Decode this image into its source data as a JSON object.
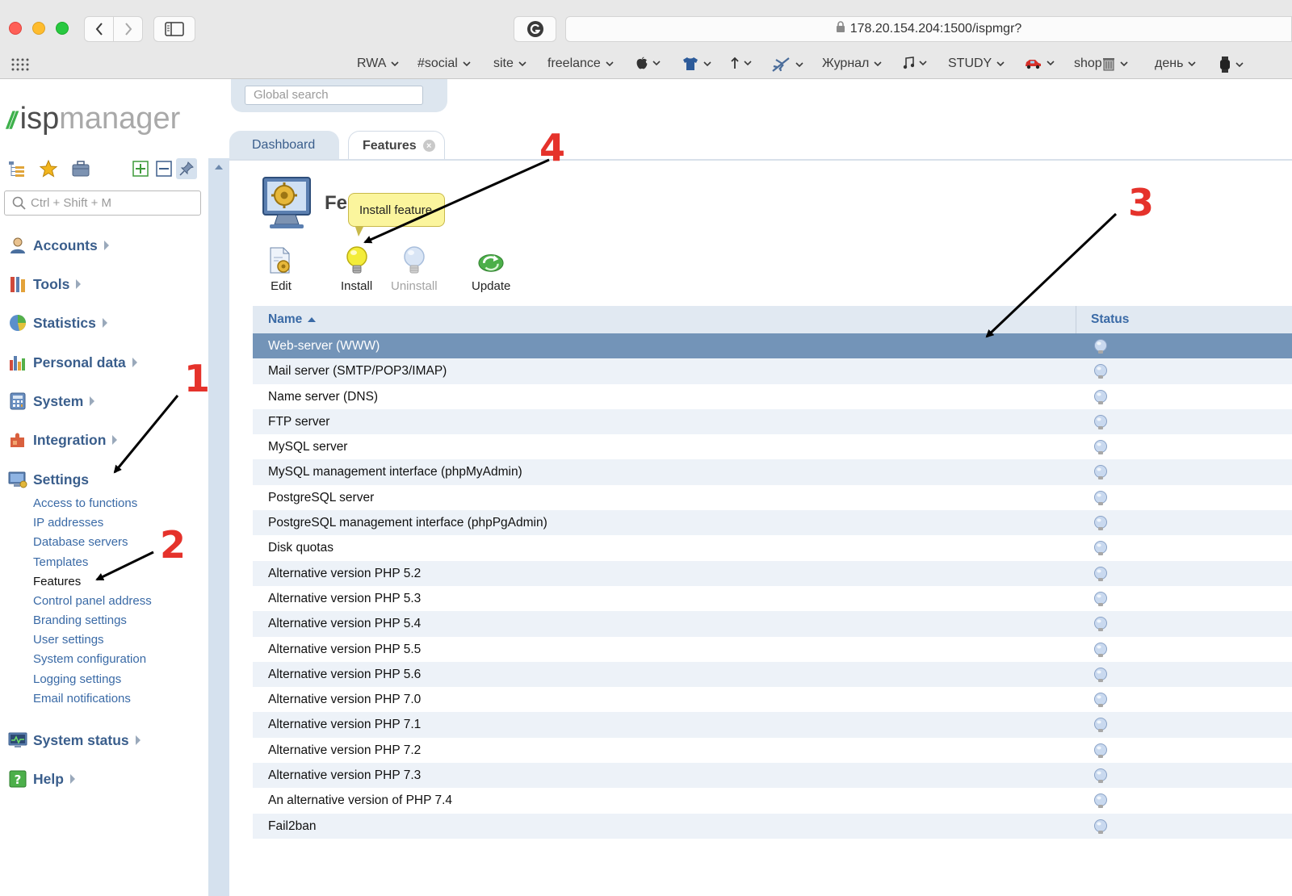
{
  "browser": {
    "url": "178.20.154.204:1500/ispmgr?",
    "bookmarks": [
      {
        "label": "RWA"
      },
      {
        "label": "#social"
      },
      {
        "label": "site"
      },
      {
        "label": "freelance"
      },
      {
        "label": ""
      },
      {
        "label": ""
      },
      {
        "label": ""
      },
      {
        "label": ""
      },
      {
        "label": "Журнал"
      },
      {
        "label": ""
      },
      {
        "label": "STUDY"
      },
      {
        "label": ""
      },
      {
        "label": "shop"
      },
      {
        "label": "день"
      },
      {
        "label": ""
      }
    ],
    "bookmark_icons": [
      "apple-icon",
      "shirt-icon",
      "arrow-up-icon",
      "plane-icon",
      "music-note-icon",
      "car-icon",
      "trash-icon",
      "watch-icon"
    ]
  },
  "logo": {
    "mark": "//",
    "isp": "isp",
    "manager": "manager"
  },
  "left_panel": {
    "search_placeholder": "Ctrl + Shift + M",
    "menu": [
      {
        "label": "Accounts"
      },
      {
        "label": "Tools"
      },
      {
        "label": "Statistics"
      },
      {
        "label": "Personal data"
      },
      {
        "label": "System"
      },
      {
        "label": "Integration"
      },
      {
        "label": "Settings"
      },
      {
        "label": "System status"
      },
      {
        "label": "Help"
      }
    ],
    "settings_items": [
      {
        "label": "Access to functions"
      },
      {
        "label": "IP addresses"
      },
      {
        "label": "Database servers"
      },
      {
        "label": "Templates"
      },
      {
        "label": "Features"
      },
      {
        "label": "Control panel address"
      },
      {
        "label": "Branding settings"
      },
      {
        "label": "User settings"
      },
      {
        "label": "System configuration"
      },
      {
        "label": "Logging settings"
      },
      {
        "label": "Email notifications"
      }
    ]
  },
  "global_search": {
    "placeholder": "Global search"
  },
  "tabs": [
    {
      "label": "Dashboard"
    },
    {
      "label": "Features"
    }
  ],
  "page": {
    "title": "Fe",
    "tooltip": "Install feature"
  },
  "toolbar": {
    "edit": "Edit",
    "install": "Install",
    "uninstall": "Uninstall",
    "update": "Update"
  },
  "table": {
    "columns": [
      "Name",
      "Status"
    ],
    "rows": [
      "Web-server (WWW)",
      "Mail server (SMTP/POP3/IMAP)",
      "Name server (DNS)",
      "FTP server",
      "MySQL server",
      "MySQL management interface (phpMyAdmin)",
      "PostgreSQL server",
      "PostgreSQL management interface (phpPgAdmin)",
      "Disk quotas",
      "Alternative version PHP 5.2",
      "Alternative version PHP 5.3",
      "Alternative version PHP 5.4",
      "Alternative version PHP 5.5",
      "Alternative version PHP 5.6",
      "Alternative version PHP 7.0",
      "Alternative version PHP 7.1",
      "Alternative version PHP 7.2",
      "Alternative version PHP 7.3",
      "An alternative version of PHP 7.4",
      "Fail2ban"
    ],
    "selected_index": 0
  },
  "annotations": [
    "1",
    "2",
    "3",
    "4"
  ],
  "colors": {
    "accent": "#3a5e8c",
    "link": "#3a6aa6",
    "selected_row": "#7394b8",
    "annotation": "#e5322b",
    "logo_green": "#3db04b"
  }
}
